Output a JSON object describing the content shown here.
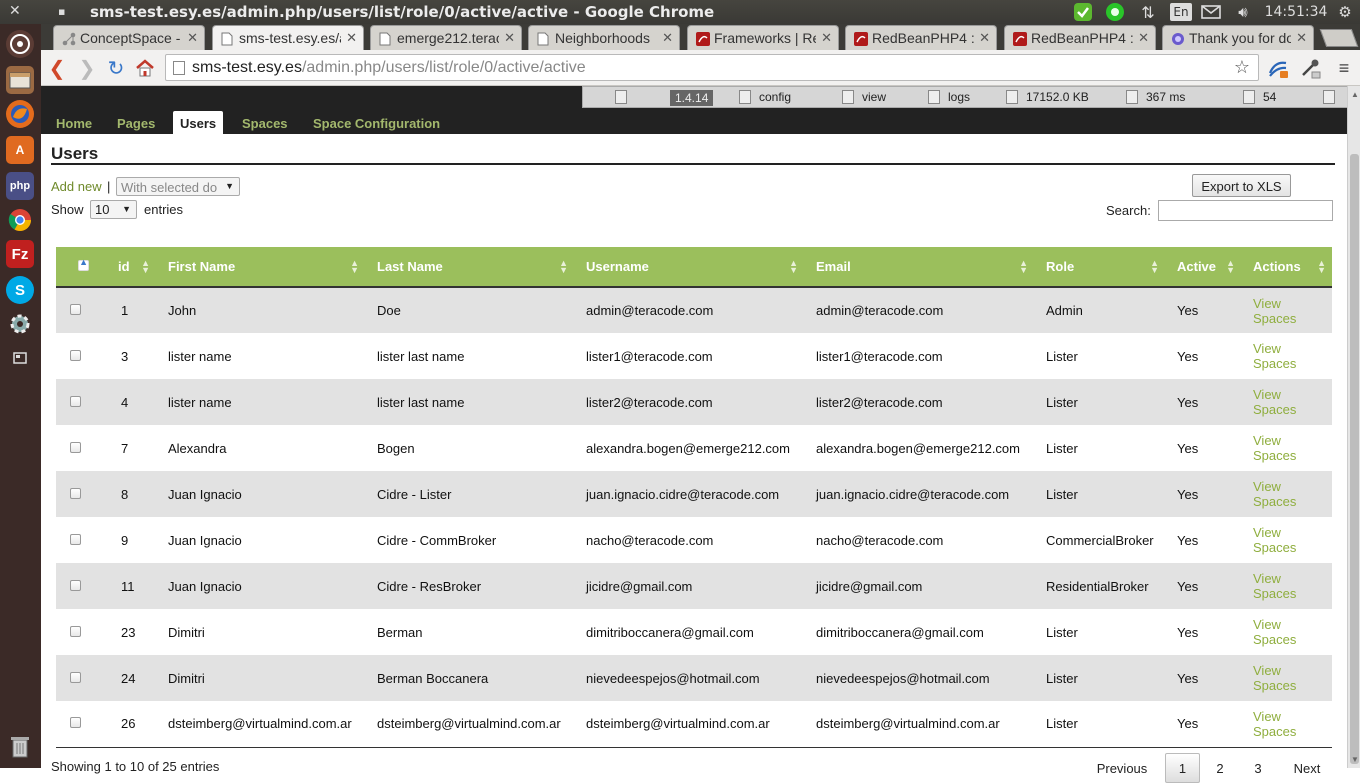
{
  "os": {
    "window_title": "sms-test.esy.es/admin.php/users/list/role/0/active/active - Google Chrome",
    "close_glyph": "✕",
    "min_glyph": "▪",
    "keyboard": "En",
    "clock": "14:51:34"
  },
  "launcher": [
    "ubuntu-icon",
    "files-icon",
    "firefox-icon",
    "software-center-icon",
    "php-icon",
    "chrome-icon",
    "filezilla-icon",
    "skype-icon",
    "system-settings-icon",
    "workspace-icon",
    "trash-icon"
  ],
  "tabs": [
    {
      "title": "ConceptSpace - Pro",
      "icon": "conceptspace-icon"
    },
    {
      "title": "sms-test.esy.es/admin",
      "icon": "page-icon"
    },
    {
      "title": "emerge212.teracode",
      "icon": "page-icon"
    },
    {
      "title": "Neighborhoods",
      "icon": "page-icon"
    },
    {
      "title": "Frameworks | Re",
      "icon": "redbean-icon"
    },
    {
      "title": "RedBeanPHP4 :: ",
      "icon": "redbean-icon"
    },
    {
      "title": "RedBeanPHP4 :: ",
      "icon": "redbean-icon"
    },
    {
      "title": "Thank you for do",
      "icon": "browser-icon"
    }
  ],
  "address": {
    "host": "sms-test.esy.es",
    "path": "/admin.php/users/list/role/0/active/active"
  },
  "debug_bar": {
    "version": "1.4.14",
    "config": "config",
    "view": "view",
    "logs": "logs",
    "memory": "17152.0 KB",
    "time": "367 ms",
    "queries": "54"
  },
  "nav": {
    "items": [
      "Home",
      "Pages",
      "Users",
      "Spaces",
      "Space Configuration"
    ],
    "active": "Users"
  },
  "page": {
    "title": "Users",
    "add_new": "Add new",
    "separator": "|",
    "bulk_select": "With selected do",
    "export": "Export to XLS",
    "show_label": "Show",
    "page_length": "10",
    "entries_label": "entries",
    "search_label": "Search:",
    "search_value": ""
  },
  "table": {
    "columns": [
      "",
      "id",
      "First Name",
      "Last Name",
      "Username",
      "Email",
      "Role",
      "Active",
      "Actions"
    ],
    "action_label_1": "View",
    "action_label_2": "Spaces",
    "rows": [
      [
        "1",
        "John",
        "Doe",
        "admin@teracode.com",
        "admin@teracode.com",
        "Admin",
        "Yes"
      ],
      [
        "3",
        "lister name",
        "lister last name",
        "lister1@teracode.com",
        "lister1@teracode.com",
        "Lister",
        "Yes"
      ],
      [
        "4",
        "lister name",
        "lister last name",
        "lister2@teracode.com",
        "lister2@teracode.com",
        "Lister",
        "Yes"
      ],
      [
        "7",
        "Alexandra",
        "Bogen",
        "alexandra.bogen@emerge212.com",
        "alexandra.bogen@emerge212.com",
        "Lister",
        "Yes"
      ],
      [
        "8",
        "Juan Ignacio",
        "Cidre - Lister",
        "juan.ignacio.cidre@teracode.com",
        "juan.ignacio.cidre@teracode.com",
        "Lister",
        "Yes"
      ],
      [
        "9",
        "Juan Ignacio",
        "Cidre - CommBroker",
        "nacho@teracode.com",
        "nacho@teracode.com",
        "CommercialBroker",
        "Yes"
      ],
      [
        "11",
        "Juan Ignacio",
        "Cidre - ResBroker",
        "jicidre@gmail.com",
        "jicidre@gmail.com",
        "ResidentialBroker",
        "Yes"
      ],
      [
        "23",
        "Dimitri",
        "Berman",
        "dimitriboccanera@gmail.com",
        "dimitriboccanera@gmail.com",
        "Lister",
        "Yes"
      ],
      [
        "24",
        "Dimitri",
        "Berman Boccanera",
        "nievedeespejos@hotmail.com",
        "nievedeespejos@hotmail.com",
        "Lister",
        "Yes"
      ],
      [
        "26",
        "dsteimberg@virtualmind.com.ar",
        "dsteimberg@virtualmind.com.ar",
        "dsteimberg@virtualmind.com.ar",
        "dsteimberg@virtualmind.com.ar",
        "Lister",
        "Yes"
      ]
    ]
  },
  "footer": {
    "info": "Showing 1 to 10 of 25 entries",
    "previous": "Previous",
    "pages": [
      "1",
      "2",
      "3"
    ],
    "current_page": "1",
    "next": "Next"
  },
  "colors": {
    "header_green": "#9bbf5c",
    "link_green": "#8fae3e",
    "nav_bg": "#222222"
  }
}
